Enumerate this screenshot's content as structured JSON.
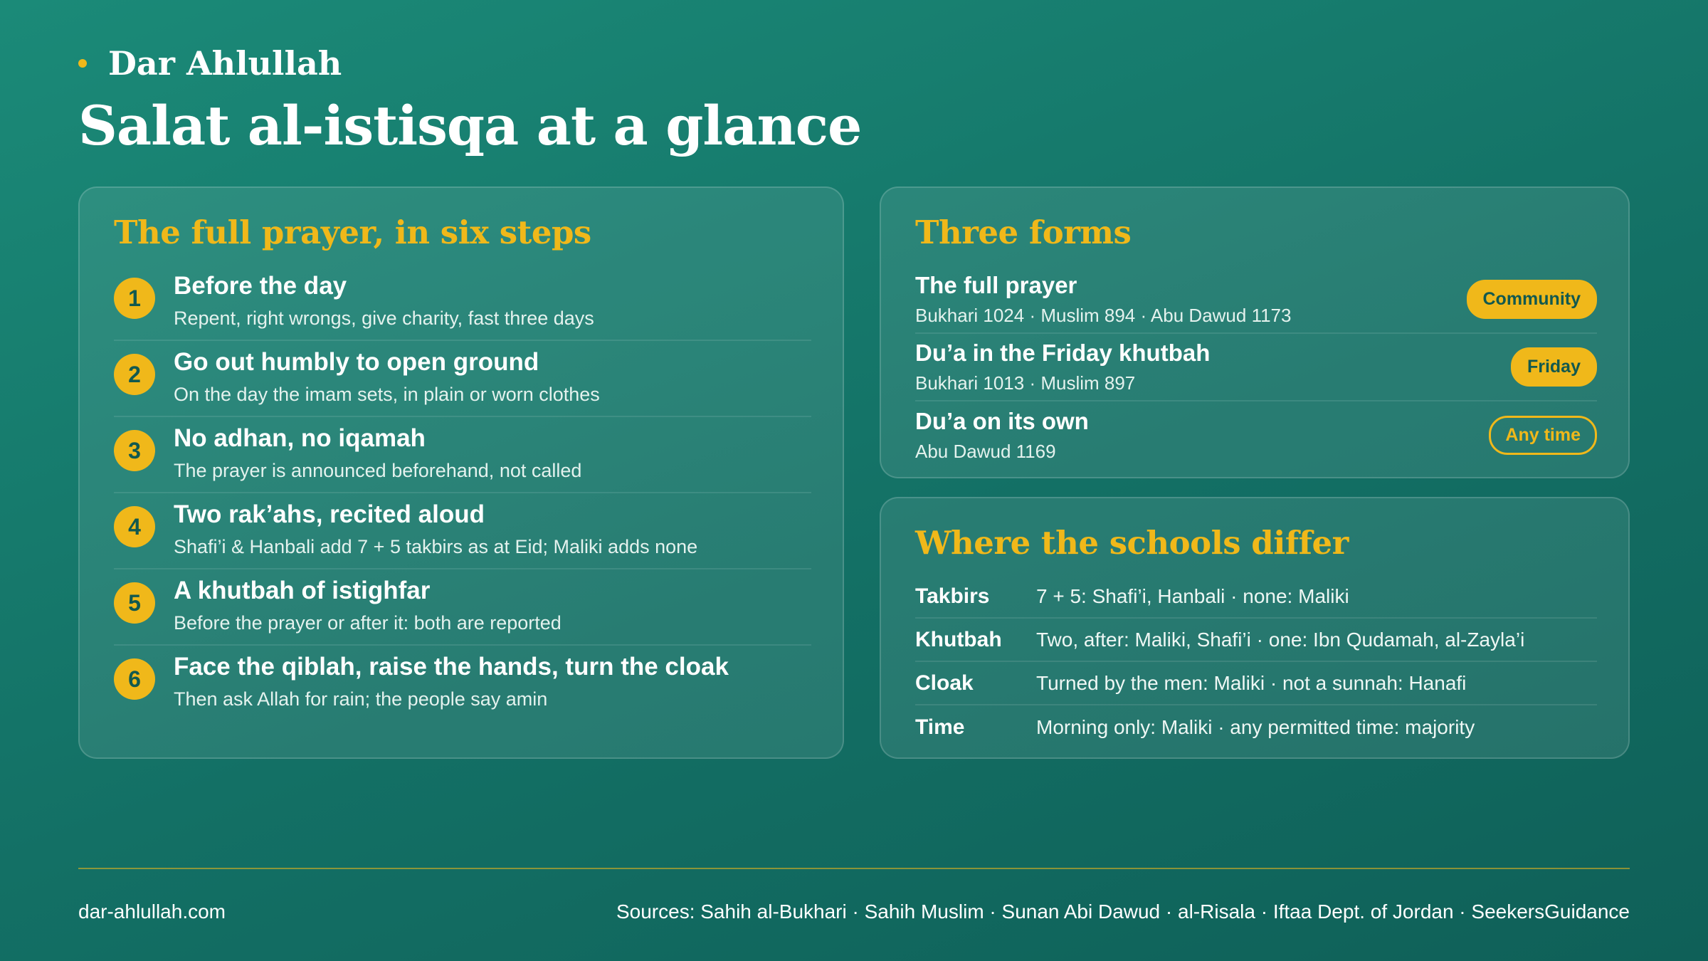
{
  "brand": {
    "name": "Dar Ahlullah"
  },
  "title": "Salat al-istisqa at a glance",
  "steps_panel": {
    "heading": "The full prayer, in six steps",
    "steps": [
      {
        "num": "1",
        "title": "Before the day",
        "desc": "Repent, right wrongs, give charity, fast three days"
      },
      {
        "num": "2",
        "title": "Go out humbly to open ground",
        "desc": "On the day the imam sets, in plain or worn clothes"
      },
      {
        "num": "3",
        "title": "No adhan, no iqamah",
        "desc": "The prayer is announced beforehand, not called"
      },
      {
        "num": "4",
        "title": "Two rak’ahs, recited aloud",
        "desc": "Shafi’i & Hanbali add 7 + 5 takbirs as at Eid; Maliki adds none"
      },
      {
        "num": "5",
        "title": "A khutbah of istighfar",
        "desc": "Before the prayer or after it: both are reported"
      },
      {
        "num": "6",
        "title": "Face the qiblah, raise the hands, turn the cloak",
        "desc": "Then ask Allah for rain; the people say amin"
      }
    ]
  },
  "forms_panel": {
    "heading": "Three forms",
    "forms": [
      {
        "title": "The full prayer",
        "refs": "Bukhari 1024 · Muslim 894 · Abu Dawud 1173",
        "badge": "Community"
      },
      {
        "title": "Du’a in the Friday khutbah",
        "refs": "Bukhari 1013 · Muslim 897",
        "badge": "Friday"
      },
      {
        "title": "Du’a on its own",
        "refs": "Abu Dawud 1169",
        "badge": "Any time"
      }
    ]
  },
  "schools_panel": {
    "heading": "Where the schools differ",
    "rows": [
      {
        "label": "Takbirs",
        "value": "7 + 5: Shafi’i, Hanbali · none: Maliki"
      },
      {
        "label": "Khutbah",
        "value": "Two, after: Maliki, Shafi’i · one: Ibn Qudamah, al-Zayla’i"
      },
      {
        "label": "Cloak",
        "value": "Turned by the men: Maliki · not a sunnah: Hanafi"
      },
      {
        "label": "Time",
        "value": "Morning only: Maliki · any permitted time: majority"
      }
    ]
  },
  "footer": {
    "site": "dar-ahlullah.com",
    "sources": "Sources: Sahih al-Bukhari · Sahih Muslim · Sunan Abi Dawud · al-Risala · Iftaa Dept. of Jordan · SeekersGuidance"
  },
  "colors": {
    "accent": "#f0b81a",
    "background": "#137065",
    "badge_text": "#12594f"
  }
}
